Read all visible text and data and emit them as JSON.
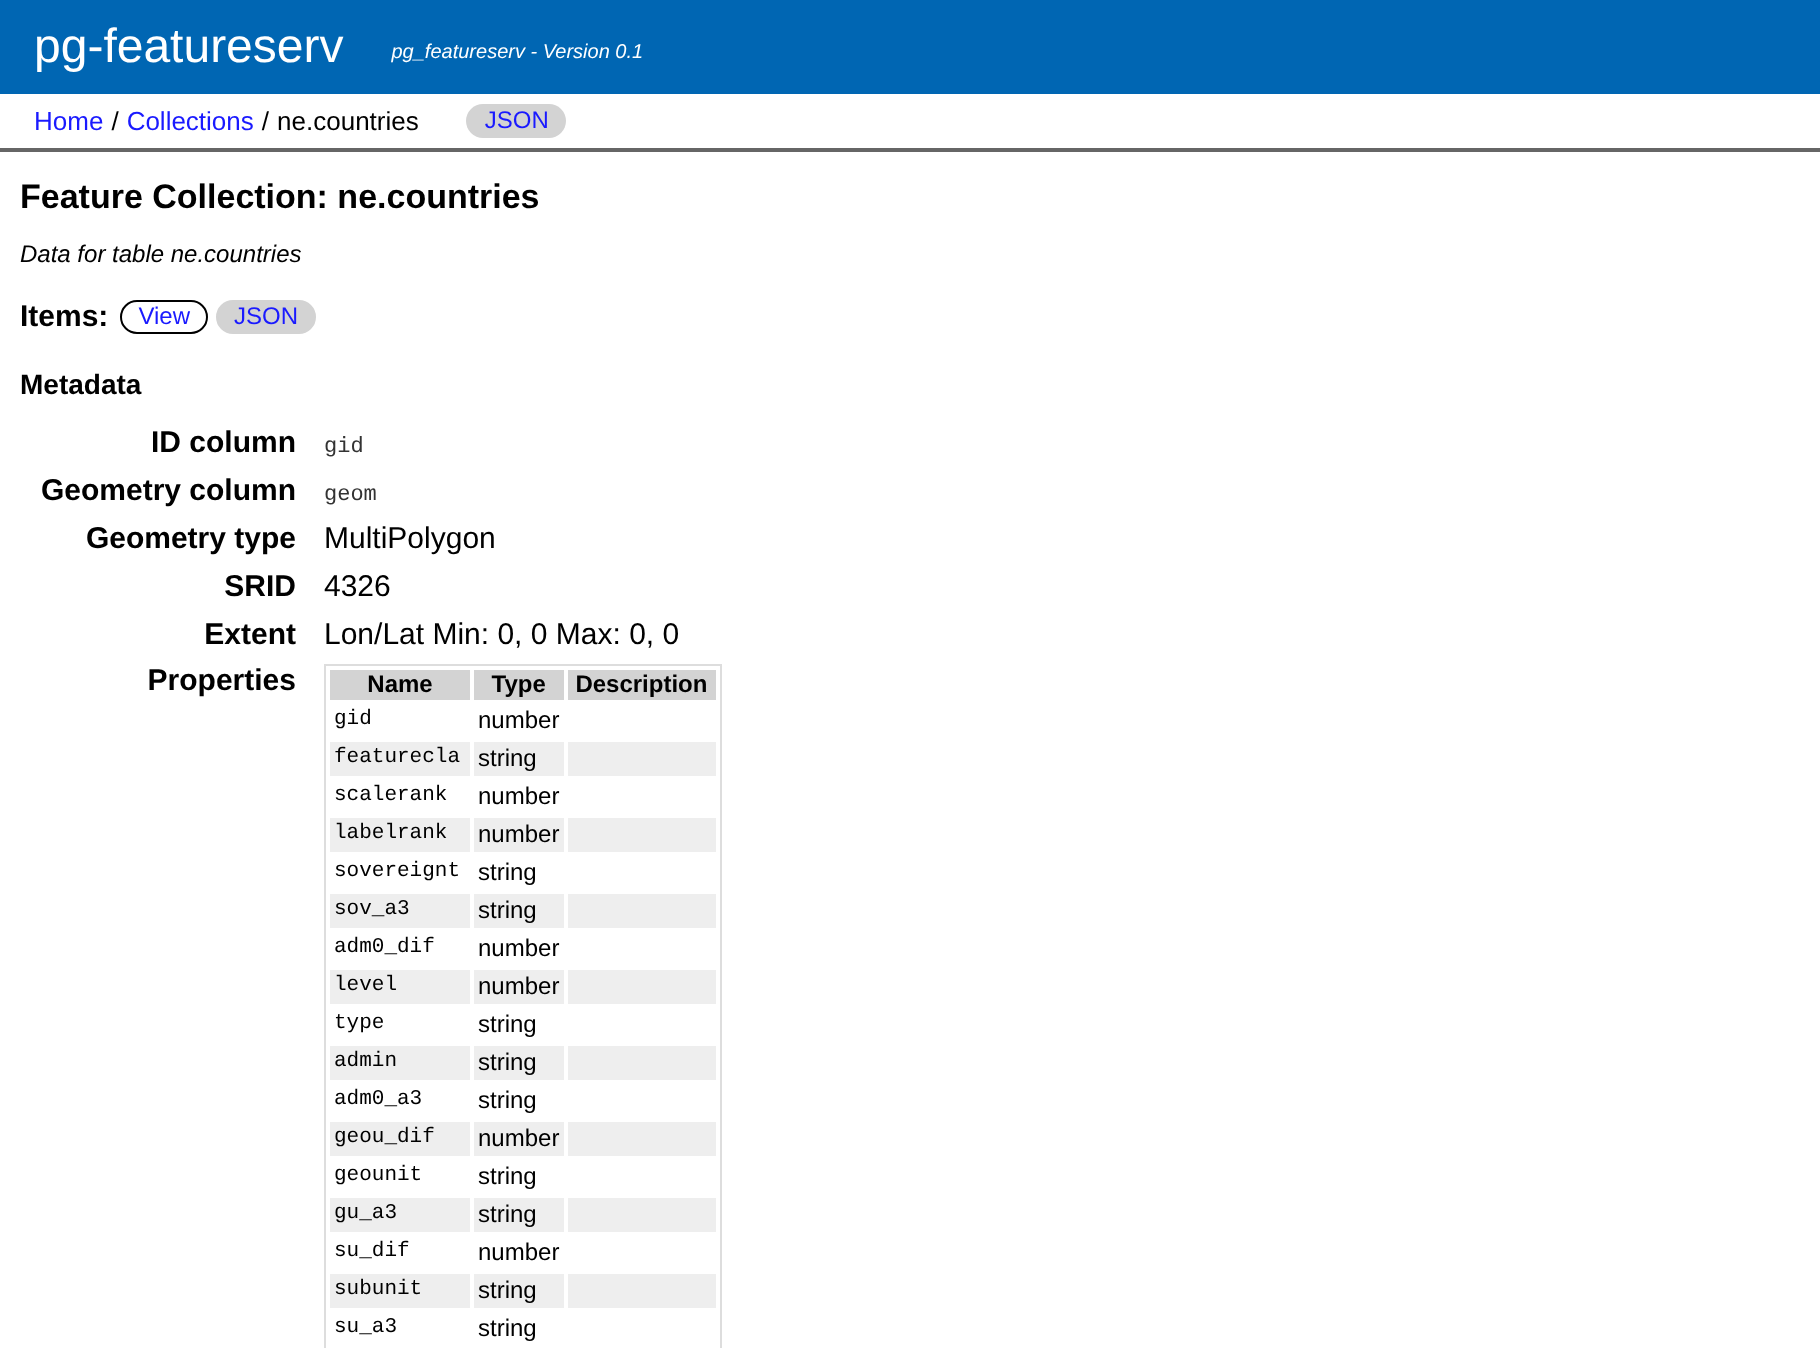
{
  "header": {
    "title": "pg-featureserv",
    "subtitle": "pg_featureserv - Version 0.1"
  },
  "breadcrumb": {
    "links": [
      "Home",
      "Collections"
    ],
    "separators": [
      "/",
      "/"
    ],
    "current": "ne.countries",
    "json_button": "JSON"
  },
  "heading": "Feature Collection: ne.countries",
  "description": "Data for table ne.countries",
  "items": {
    "label": "Items:",
    "buttons": [
      {
        "label": "View",
        "kind": "outline"
      },
      {
        "label": "JSON",
        "kind": "filled"
      }
    ]
  },
  "metadata": {
    "heading": "Metadata",
    "fields": [
      {
        "label": "ID column",
        "value": "gid",
        "kind": "code"
      },
      {
        "label": "Geometry column",
        "value": "geom",
        "kind": "code"
      },
      {
        "label": "Geometry type",
        "value": "MultiPolygon",
        "kind": "text"
      },
      {
        "label": "SRID",
        "value": "4326",
        "kind": "text"
      },
      {
        "label": "Extent",
        "value": "Lon/Lat Min: 0, 0 Max: 0, 0",
        "kind": "text"
      }
    ],
    "properties_label": "Properties",
    "properties": {
      "columns": [
        "Name",
        "Type",
        "Description"
      ],
      "rows": [
        [
          "gid",
          "number"
        ],
        [
          "featurecla",
          "string"
        ],
        [
          "scalerank",
          "number"
        ],
        [
          "labelrank",
          "number"
        ],
        [
          "sovereignt",
          "string"
        ],
        [
          "sov_a3",
          "string"
        ],
        [
          "adm0_dif",
          "number"
        ],
        [
          "level",
          "number"
        ],
        [
          "type",
          "string"
        ],
        [
          "admin",
          "string"
        ],
        [
          "adm0_a3",
          "string"
        ],
        [
          "geou_dif",
          "number"
        ],
        [
          "geounit",
          "string"
        ],
        [
          "gu_a3",
          "string"
        ],
        [
          "su_dif",
          "number"
        ],
        [
          "subunit",
          "string"
        ],
        [
          "su_a3",
          "string"
        ]
      ]
    }
  }
}
